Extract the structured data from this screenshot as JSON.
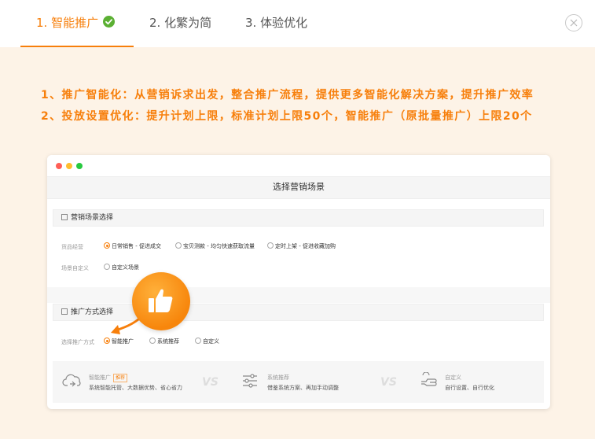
{
  "tabs": [
    {
      "label": "1. 智能推广",
      "active": true
    },
    {
      "label": "2. 化繁为简",
      "active": false
    },
    {
      "label": "3. 体验优化",
      "active": false
    }
  ],
  "features": [
    "1、推广智能化：从营销诉求出发，整合推广流程，提供更多智能化解决方案，提升推广效率",
    "2、投放设置优化：提升计划上限，标准计划上限50个，智能推广（原批量推广）上限20个"
  ],
  "window": {
    "title": "选择营销场景",
    "section1": {
      "title": "营销场景选择",
      "row1_label": "货品经营",
      "row1_options": [
        "日常销售 - 促进成交",
        "宝贝测款 - 均匀快速获取流量",
        "定时上架 - 促进收藏加购"
      ],
      "row2_label": "场景自定义",
      "row2_options": [
        "自定义场景"
      ]
    },
    "section2": {
      "title": "推广方式选择",
      "row_label": "选择推广方式",
      "options": [
        "智能推广",
        "系统推荐",
        "自定义"
      ]
    },
    "cards": [
      {
        "title": "智能推广",
        "badge": "推荐",
        "desc": "系统智能托管、大数据优势、省心省力"
      },
      {
        "title": "系统推荐",
        "desc": "借鉴系统方案、再加手动调整"
      },
      {
        "title": "自定义",
        "desc": "自行设置、自行优化"
      }
    ],
    "vs": "VS"
  },
  "colors": {
    "accent": "#f77f0b",
    "check": "#5bb033",
    "background": "#fdf3e7"
  }
}
